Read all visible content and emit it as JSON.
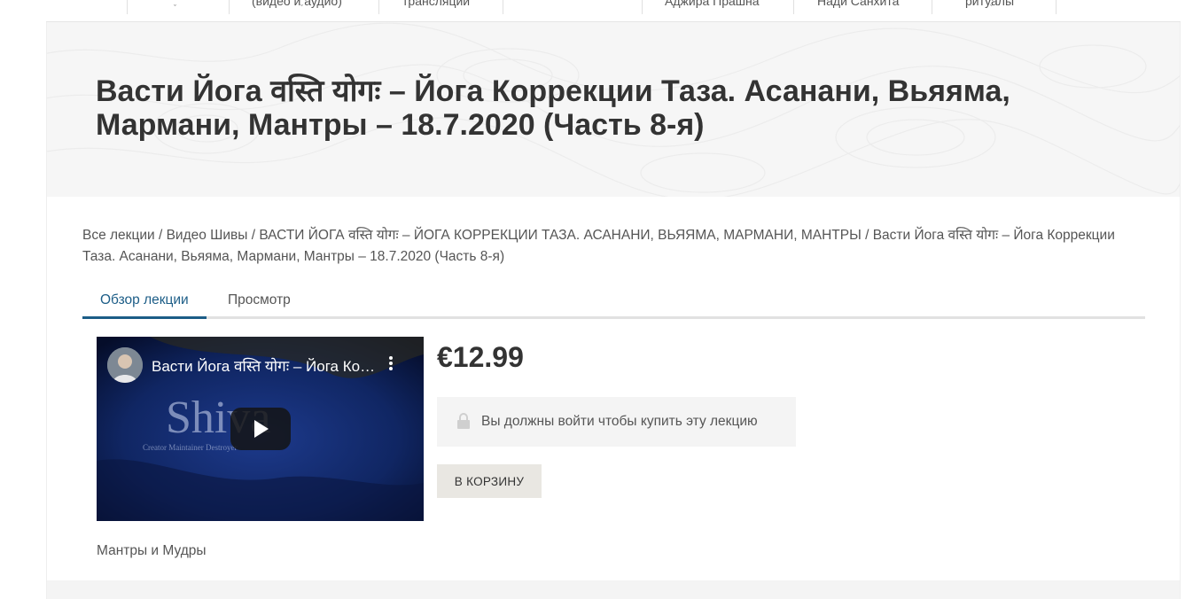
{
  "nav": {
    "items": [
      {
        "label": ""
      },
      {
        "label": "(видео и аудио)"
      },
      {
        "label": "трансляции"
      },
      {
        "label": ""
      },
      {
        "label": "Аджира Прашна"
      },
      {
        "label": "Нади Санхита"
      },
      {
        "label": "ритуалы"
      }
    ]
  },
  "page": {
    "title": "Васти Йога वस्ति योगः – Йога Коррекции Таза. Асанани, Вьяяма, Мармани, Мантры – 18.7.2020 (Часть 8-я)"
  },
  "breadcrumb": {
    "item1": "Все лекции",
    "item2": "Видео Шивы",
    "item3": "ВАСТИ ЙОГА वस्ति योगः – ЙОГА КОРРЕКЦИИ ТАЗА. АСАНАНИ, ВЬЯЯМА, МАРМАНИ, МАНТРЫ",
    "current": "Васти Йога वस्ति योगः – Йога Коррекции Таза. Асанани, Вьяяма, Мармани, Мантры – 18.7.2020 (Часть 8-я)",
    "separator": " / "
  },
  "tabs": [
    {
      "label": "Обзор лекции",
      "active": true
    },
    {
      "label": "Просмотр",
      "active": false
    }
  ],
  "video": {
    "title": "Васти Йога वस्ति योगः – Йога Коррекции Таза",
    "logo_text": "Shiva",
    "logo_subtext": "Creator Maintainer Destroyer"
  },
  "product": {
    "price": "€12.99",
    "login_message": "Вы должны войти чтобы купить эту лекцию",
    "cart_button": "В КОРЗИНУ",
    "category": "Мантры и Мудры"
  },
  "colors": {
    "accent": "#1c5d87",
    "video_bg": "#0b1d52",
    "button_bg": "#e9e7e2"
  }
}
